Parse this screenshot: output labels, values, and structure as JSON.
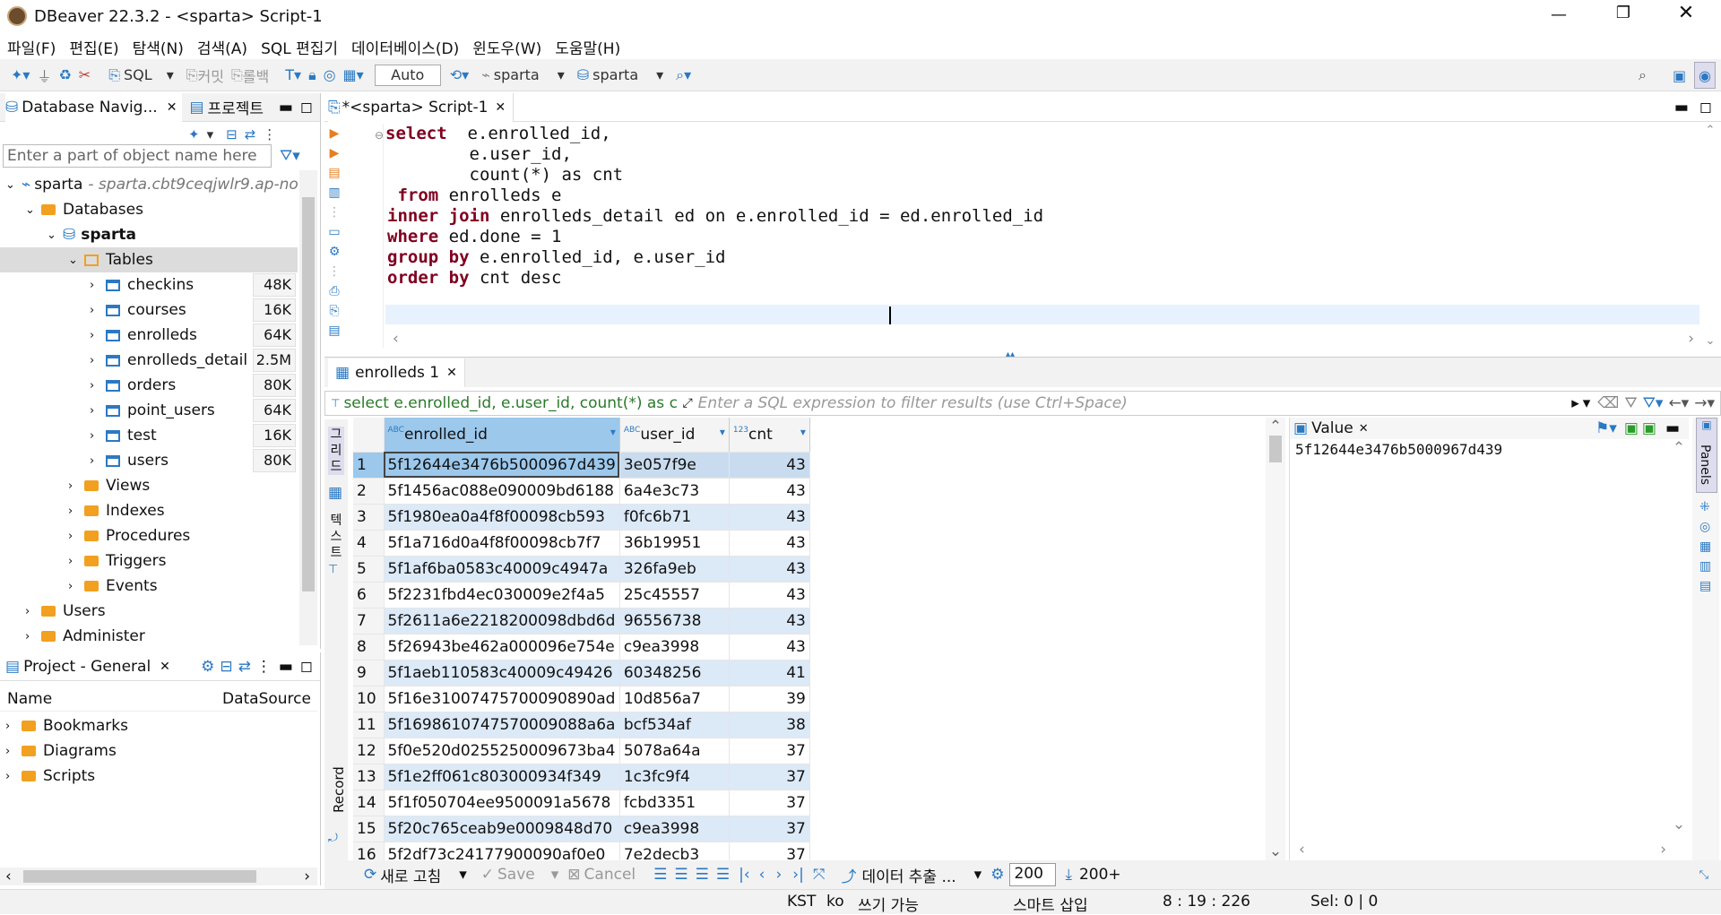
{
  "window": {
    "title": "DBeaver 22.3.2 - <sparta> Script-1"
  },
  "menu": [
    "파일(F)",
    "편집(E)",
    "탐색(N)",
    "검색(A)",
    "SQL 편집기",
    "데이터베이스(D)",
    "윈도우(W)",
    "도움말(H)"
  ],
  "toolbar": {
    "sql_label": "SQL",
    "commit_label": "커밋",
    "rollback_label": "롤백",
    "auto_label": "Auto",
    "datasource": "sparta",
    "schema": "sparta"
  },
  "navigator": {
    "tab_label": "Database Navig...",
    "project_tab_label": "프로젝트",
    "filter_placeholder": "Enter a part of object name here",
    "connection": "sparta",
    "connection_host": "- sparta.cbt9ceqjwlr9.ap-no",
    "databases_label": "Databases",
    "db_name": "sparta",
    "tables_label": "Tables",
    "tables": [
      {
        "name": "checkins",
        "size": "48K"
      },
      {
        "name": "courses",
        "size": "16K"
      },
      {
        "name": "enrolleds",
        "size": "64K"
      },
      {
        "name": "enrolleds_detail",
        "size": "2.5M"
      },
      {
        "name": "orders",
        "size": "80K"
      },
      {
        "name": "point_users",
        "size": "64K"
      },
      {
        "name": "test",
        "size": "16K"
      },
      {
        "name": "users",
        "size": "80K"
      }
    ],
    "folders": [
      "Views",
      "Indexes",
      "Procedures",
      "Triggers",
      "Events"
    ],
    "users_label": "Users",
    "administer_label": "Administer"
  },
  "project": {
    "tab_label": "Project - General",
    "col_name": "Name",
    "col_datasource": "DataSource",
    "items": [
      "Bookmarks",
      "Diagrams",
      "Scripts"
    ]
  },
  "editor": {
    "tab_label": "*<sparta> Script-1",
    "lines": [
      {
        "kw": "select",
        "rest": "  e.enrolled_id,"
      },
      {
        "kw": "",
        "rest": "        e.user_id,"
      },
      {
        "kw": "",
        "rest": "        count(*) as cnt"
      },
      {
        "kw": " from",
        "rest": " enrolleds e"
      },
      {
        "kw": "inner join",
        "rest": " enrolleds_detail ed on e.enrolled_id = ed.enrolled_id"
      },
      {
        "kw": "where",
        "rest": " ed.done = 1"
      },
      {
        "kw": "group by",
        "rest": " e.enrolled_id, e.user_id"
      },
      {
        "kw": "order by",
        "rest": " cnt desc"
      }
    ]
  },
  "results": {
    "tab_label": "enrolleds 1",
    "query_preview": "select e.enrolled_id, e.user_id, count(*) as cn",
    "filter_placeholder": "Enter a SQL expression to filter results (use Ctrl+Space)",
    "columns": [
      "enrolled_id",
      "user_id",
      "cnt"
    ],
    "rows": [
      [
        "1",
        "5f12644e3476b5000967d439",
        "3e057f9e",
        "43"
      ],
      [
        "2",
        "5f1456ac088e090009bd6188",
        "6a4e3c73",
        "43"
      ],
      [
        "3",
        "5f1980ea0a4f8f00098cb593",
        "f0fc6b71",
        "43"
      ],
      [
        "4",
        "5f1a716d0a4f8f00098cb7f7",
        "36b19951",
        "43"
      ],
      [
        "5",
        "5f1af6ba0583c40009c4947a",
        "326fa9eb",
        "43"
      ],
      [
        "6",
        "5f2231fbd4ec030009e2f4a5",
        "25c45557",
        "43"
      ],
      [
        "7",
        "5f2611a6e2218200098dbd6d",
        "96556738",
        "43"
      ],
      [
        "8",
        "5f26943be462a000096e754e",
        "c9ea3998",
        "43"
      ],
      [
        "9",
        "5f1aeb110583c40009c49426",
        "60348256",
        "41"
      ],
      [
        "10",
        "5f16e31007475700090890ad",
        "10d856a7",
        "39"
      ],
      [
        "11",
        "5f1698610747570009088a6a",
        "bcf534af",
        "38"
      ],
      [
        "12",
        "5f0e520d0255250009673ba4",
        "5078a64a",
        "37"
      ],
      [
        "13",
        "5f1e2ff061c803000934f349",
        "1c3fc9f4",
        "37"
      ],
      [
        "14",
        "5f1f050704ee9500091a5678",
        "fcbd3351",
        "37"
      ],
      [
        "15",
        "5f20c765ceab9e0009848d70",
        "c9ea3998",
        "37"
      ],
      [
        "16",
        "5f2df73c24177900090af0e0",
        "7e2decb3",
        "37"
      ]
    ],
    "value_panel_label": "Value",
    "value_text": "5f12644e3476b5000967d439",
    "side_grid": "그리드",
    "side_text": "텍스트",
    "side_record": "Record",
    "panels_label": "Panels"
  },
  "bottom_toolbar": {
    "refresh": "새로 고침",
    "save": "Save",
    "cancel": "Cancel",
    "export": "데이터 추출 ...",
    "fetch_size": "200",
    "row_count": "200+"
  },
  "status": {
    "tz": "KST",
    "lang": "ko",
    "writable": "쓰기 가능",
    "insert_mode": "스마트 삽입",
    "cursor": "8 : 19 : 226",
    "sel": "Sel: 0 | 0"
  }
}
